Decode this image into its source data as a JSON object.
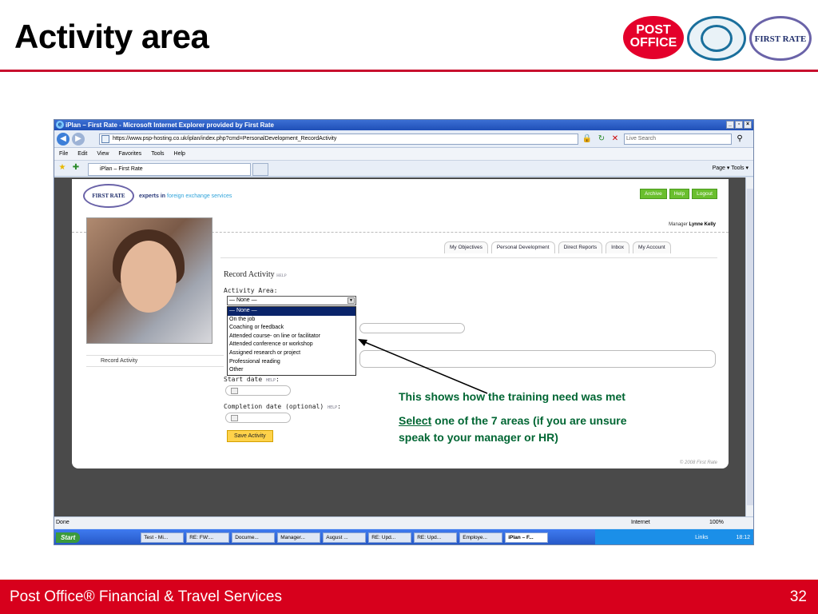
{
  "slide": {
    "title": "Activity area",
    "page_number": "32",
    "footer": "Post Office® Financial & Travel Services"
  },
  "logos": {
    "post_office": "POST OFFICE",
    "first_rate": "FIRST RATE"
  },
  "browser": {
    "window_title": "iPlan – First Rate - Microsoft Internet Explorer provided by First Rate",
    "url": "https://www.psp-hosting.co.uk/iplan/index.php?cmd=PersonalDevelopment_RecordActivity",
    "search_placeholder": "Live Search",
    "menu": [
      "File",
      "Edit",
      "View",
      "Favorites",
      "Tools",
      "Help"
    ],
    "tab_label": "iPlan – First Rate",
    "command_bar": "Page ▾  Tools ▾",
    "status_left": "Done",
    "status_zone": "Internet",
    "zoom": "100%"
  },
  "site": {
    "logo": "FIRST RATE",
    "tagline_a": "experts in",
    "tagline_b": "foreign exchange services",
    "buttons": [
      "Archive",
      "Help",
      "Logout"
    ],
    "manager_label": "Manager",
    "manager_name": "Lynne Kelly",
    "tabs": [
      "My Objectives",
      "Personal Development",
      "Direct Reports",
      "Inbox",
      "My Account"
    ],
    "left_nav": "Record Activity",
    "form_title": "Record Activity",
    "help": "HELP",
    "activity_area_label": "Activity Area:",
    "select_value": "— None —",
    "options": [
      "— None —",
      "On the job",
      "Coaching or feedback",
      "Attended course- on line or facilitator",
      "Attended conference or workshop",
      "Assigned research or project",
      "Professional reading",
      "Other"
    ],
    "start_date_label": "Start date",
    "completion_label": "Completion date (optional)",
    "save_button": "Save Activity",
    "copyright": "© 2008 First Rate"
  },
  "taskbar": {
    "start": "Start",
    "tasks": [
      "Test - Mi...",
      "RE: FW:...",
      "Docume...",
      "Manager...",
      "August ...",
      "RE: Upd...",
      "RE: Upd...",
      "Employe...",
      "iPlan – F..."
    ],
    "links": "Links",
    "time": "18:12"
  },
  "annotation": {
    "line1": "This shows how the training need was met",
    "select_word": "Select",
    "line2_rest": " one of the 7 areas (if you are unsure",
    "line3": "speak to your manager or HR)"
  },
  "colors": {
    "accent_red": "#d7001c",
    "annotation_green": "#006633"
  }
}
